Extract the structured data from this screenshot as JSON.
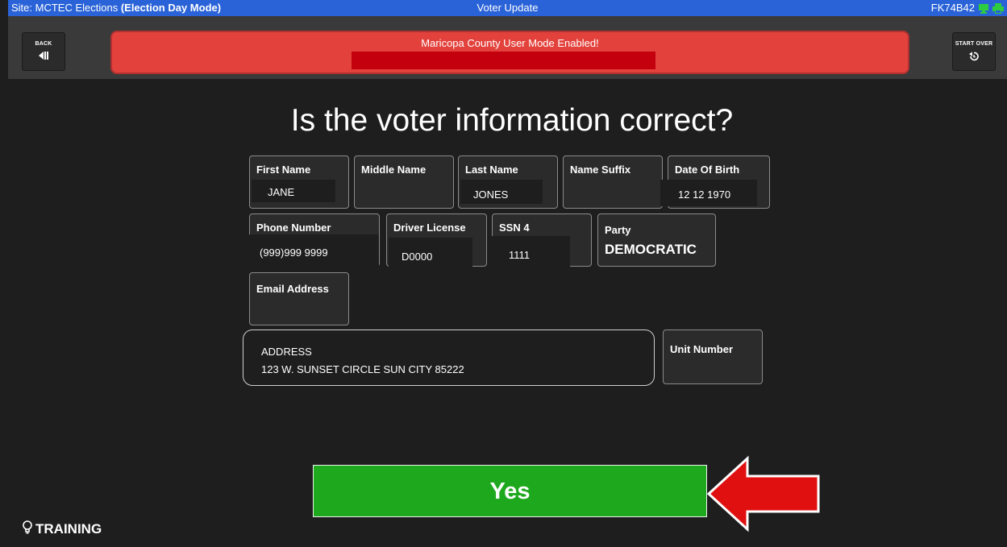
{
  "titlebar": {
    "site_label": "Site: MCTEC Elections",
    "mode": "(Election Day Mode)",
    "title": "Voter Update",
    "device_id": "FK74B42"
  },
  "nav": {
    "back_label": "BACK",
    "start_over_label": "START OVER"
  },
  "banner": {
    "text": "Maricopa County User Mode Enabled!"
  },
  "question": "Is the voter information correct?",
  "fields": {
    "first_name": {
      "label": "First Name",
      "value": "JANE"
    },
    "middle_name": {
      "label": "Middle Name",
      "value": ""
    },
    "last_name": {
      "label": "Last Name",
      "value": "JONES"
    },
    "name_suffix": {
      "label": "Name Suffix",
      "value": ""
    },
    "date_of_birth": {
      "label": "Date Of Birth",
      "value": "12 12 1970"
    },
    "phone_number": {
      "label": "Phone Number",
      "value": "(999)999 9999"
    },
    "driver_license": {
      "label": "Driver License",
      "value": "D0000"
    },
    "ssn4": {
      "label": "SSN 4",
      "value": "1111"
    },
    "party": {
      "label": "Party",
      "value": "DEMOCRATIC"
    },
    "email": {
      "label": "Email Address",
      "value": ""
    },
    "unit_number": {
      "label": "Unit Number",
      "value": ""
    }
  },
  "address": {
    "label": "ADDRESS",
    "value": "123 W.  SUNSET CIRCLE SUN CITY 85222"
  },
  "yes_label": "Yes",
  "training_label": "TRAINING",
  "colors": {
    "titlebar": "#2a63d8",
    "banner": "#e3423c",
    "yes_button": "#1ea81e",
    "arrow": "#e01010"
  },
  "icons": {
    "back": "back-icon",
    "start_over": "undo-icon",
    "monitor": "monitor-icon",
    "printer": "printer-icon",
    "training": "lightbulb-icon"
  }
}
